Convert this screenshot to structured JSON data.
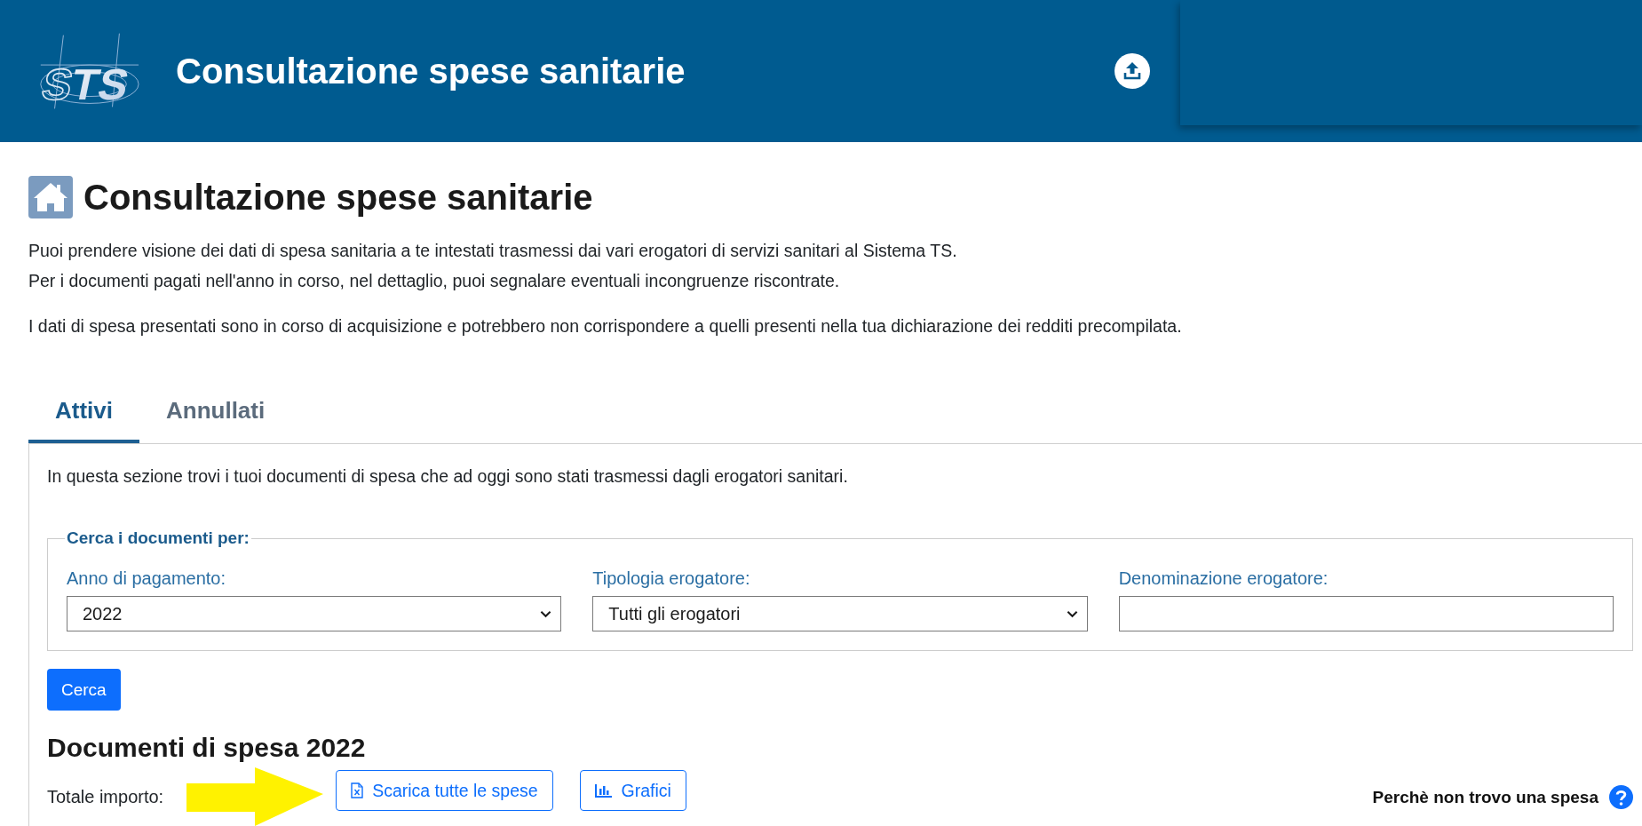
{
  "header": {
    "logo": "STS",
    "title": "Consultazione spese sanitarie"
  },
  "page": {
    "title": "Consultazione spese sanitarie",
    "intro": [
      {
        "lines": [
          "Puoi prendere visione dei dati di spesa sanitaria a te intestati trasmessi dai vari erogatori di servizi sanitari al Sistema TS.",
          "Per i documenti pagati nell'anno in corso, nel dettaglio, puoi segnalare eventuali incongruenze riscontrate."
        ]
      },
      {
        "lines": [
          "I dati di spesa presentati sono in corso di acquisizione e potrebbero non corrispondere a quelli presenti nella tua dichiarazione dei redditi precompilata."
        ]
      }
    ]
  },
  "tabs": [
    {
      "label": "Attivi",
      "selected": true
    },
    {
      "label": "Annullati",
      "selected": false
    }
  ],
  "panel": {
    "description": "In questa sezione trovi i tuoi documenti di spesa che ad oggi sono stati trasmessi dagli erogatori sanitari.",
    "search": {
      "legend": "Cerca i documenti per:",
      "fields": [
        {
          "kind": "select",
          "label": "Anno di pagamento:",
          "value": "2022"
        },
        {
          "kind": "select",
          "label": "Tipologia erogatore:",
          "value": "Tutti gli erogatori"
        },
        {
          "kind": "text",
          "label": "Denominazione erogatore:"
        }
      ],
      "button": "Cerca"
    },
    "results": {
      "title": "Documenti di spesa 2022",
      "total_label": "Totale importo:",
      "actions": [
        {
          "kind": "spreadsheet",
          "label": "Scarica tutte le spese"
        },
        {
          "kind": "chart",
          "label": "Grafici"
        }
      ],
      "help_link": "Perchè non trovo una spesa"
    }
  }
}
